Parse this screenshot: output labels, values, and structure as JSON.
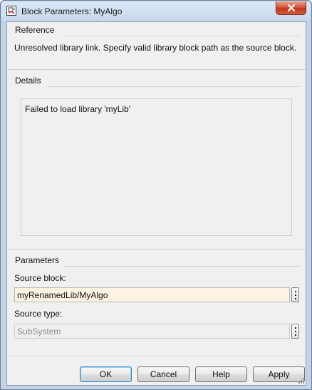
{
  "window": {
    "title": "Block Parameters: MyAlgo"
  },
  "reference": {
    "heading": "Reference",
    "message": "Unresolved library link. Specify valid library block path as the source block."
  },
  "details": {
    "heading": "Details",
    "message": "Failed to load library 'myLib'"
  },
  "parameters": {
    "heading": "Parameters",
    "source_block_label": "Source block:",
    "source_block_value": "myRenamedLib/MyAlgo",
    "source_type_label": "Source type:",
    "source_type_value": "SubSystem"
  },
  "buttons": {
    "ok": "OK",
    "cancel": "Cancel",
    "help": "Help",
    "apply": "Apply"
  },
  "icons": {
    "app": "simulink-block-icon",
    "close": "close-icon",
    "browse": "vertical-ellipsis-icon"
  },
  "colors": {
    "close_button": "#c4351a",
    "editable_field_bg": "#fdf3e2",
    "default_button_border": "#3c7fb1"
  }
}
